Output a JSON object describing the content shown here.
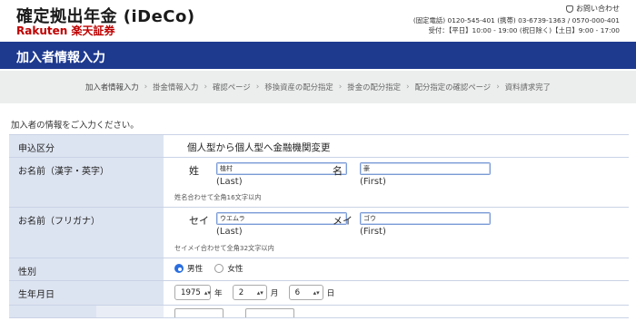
{
  "header": {
    "title": "確定拠出年金 (iDeCo)",
    "brand": "Rakuten 楽天証券",
    "contact_title": "お問い合わせ",
    "contact_phones": "(固定電話) 0120-545-401 (携帯) 03-6739-1363 / 0570-000-401",
    "contact_hours": "受付：【平日】10:00 - 19:00 (祝日除く)【土日】9:00 - 17:00"
  },
  "page_title": "加入者情報入力",
  "steps": [
    {
      "label": "加入者情報入力"
    },
    {
      "label": "掛金情報入力"
    },
    {
      "label": "確認ページ"
    },
    {
      "label": "移換資産の配分指定"
    },
    {
      "label": "掛金の配分指定"
    },
    {
      "label": "配分指定の確認ページ"
    },
    {
      "label": "資料請求完了"
    }
  ],
  "lead_text": "加入者の情報をご入力ください。",
  "form": {
    "apply_type": {
      "label": "申込区分",
      "value": "個人型から個人型へ金融機関変更"
    },
    "name": {
      "label": "お名前（漢字・英字）",
      "last_label": "姓",
      "last_value": "植村",
      "last_sub": "(Last)",
      "first_label": "名",
      "first_value": "豪",
      "first_sub": "(First)",
      "hint": "姓名合わせて全角16文字以内"
    },
    "kana": {
      "label": "お名前（フリガナ）",
      "last_label": "セイ",
      "last_value": "ウエムラ",
      "last_sub": "(Last)",
      "first_label": "メイ",
      "first_value": "ゴウ",
      "first_sub": "(First)",
      "hint": "セイメイ合わせて全角32文字以内"
    },
    "sex": {
      "label": "性別",
      "options": [
        "男性",
        "女性"
      ],
      "selected": "男性"
    },
    "dob": {
      "label": "生年月日",
      "year": "1975",
      "year_unit": "年",
      "month": "2",
      "month_unit": "月",
      "day": "6",
      "day_unit": "日"
    }
  },
  "colors": {
    "title_bar": "#1e3a8f",
    "label_bg": "#dde4f1",
    "brand_red": "#bf0000",
    "radio_on": "#2a6ee0"
  }
}
